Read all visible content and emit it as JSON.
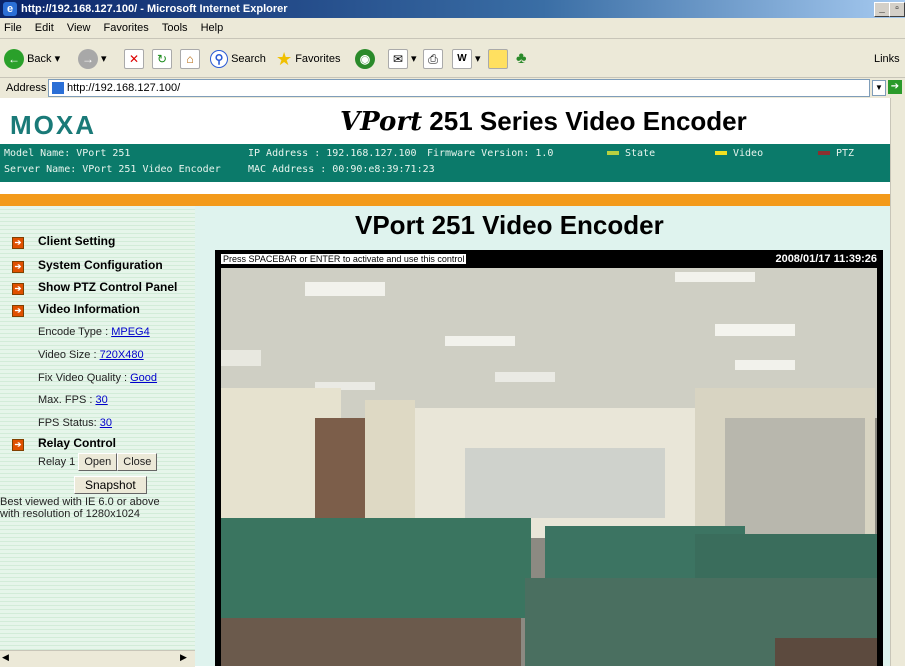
{
  "window": {
    "title": "http://192.168.127.100/ - Microsoft Internet Explorer"
  },
  "menu": [
    "File",
    "Edit",
    "View",
    "Favorites",
    "Tools",
    "Help"
  ],
  "toolbar": {
    "back": "Back",
    "search": "Search",
    "favorites": "Favorites",
    "links": "Links"
  },
  "address": {
    "label": "Address",
    "url": "http://192.168.127.100/"
  },
  "header": {
    "logo": "MOXA",
    "title_brand": "VPort",
    "title_rest": " 251 Series Video Encoder"
  },
  "infobar": {
    "model": "Model Name: VPort 251",
    "server": "Server Name: VPort 251 Video Encoder",
    "ip": "IP Address : 192.168.127.100",
    "mac": "MAC Address : 00:90:e8:39:71:23",
    "firmware": "Firmware Version: 1.0",
    "state": "State",
    "video": "Video",
    "ptz": "PTZ"
  },
  "sidebar": {
    "client_setting": "Client Setting",
    "system_configuration": "System Configuration",
    "show_ptz": "Show PTZ Control Panel",
    "video_information": "Video Information",
    "encode_type_label": "Encode Type : ",
    "encode_type": "MPEG4",
    "video_size_label": "Video Size : ",
    "video_size": "720X480",
    "fix_quality_label": "Fix Video Quality : ",
    "fix_quality": "Good",
    "max_fps_label": "Max. FPS : ",
    "max_fps": "30",
    "fps_status_label": "FPS Status: ",
    "fps_status": "30",
    "relay_control": "Relay Control",
    "relay1_label": "Relay 1",
    "open": "Open",
    "close": "Close",
    "snapshot": "Snapshot",
    "best_viewed": "Best viewed with IE 6.0 or above with resolution of 1280x1024"
  },
  "main": {
    "title": "VPort 251 Video Encoder",
    "activate_tip": "Press SPACEBAR or ENTER to activate and use this control",
    "timestamp": "2008/01/17 11:39:26"
  },
  "colors": {
    "header_green": "#0b7a6a",
    "orange": "#f39a1a",
    "sidebar_bg": "#e6f5ea"
  }
}
